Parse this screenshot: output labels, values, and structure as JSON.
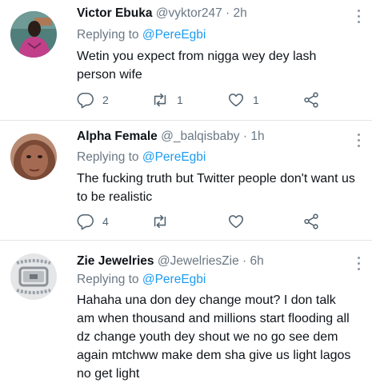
{
  "tweets": [
    {
      "name": "Victor Ebuka",
      "handle": "@vyktor247",
      "separator": "·",
      "time": "2h",
      "replying_prefix": "Replying to",
      "replying_to": "@PereEgbi",
      "text": "Wetin you expect from nigga wey dey lash person wife",
      "replies": "2",
      "retweets": "1",
      "likes": "1",
      "avatar_bg": "#4a7a78"
    },
    {
      "name": "Alpha Female",
      "handle": "@_balqisbaby",
      "separator": "·",
      "time": "1h",
      "replying_prefix": "Replying to",
      "replying_to": "@PereEgbi",
      "text": "The fucking truth but Twitter people don't want us to be realistic",
      "replies": "4",
      "retweets": "",
      "likes": "",
      "avatar_bg": "#8a5a48"
    },
    {
      "name": "Zie Jewelries",
      "handle": "@JewelriesZie",
      "separator": "·",
      "time": "6h",
      "replying_prefix": "Replying to",
      "replying_to": "@PereEgbi",
      "text": "Hahaha una don dey change mout? I don talk am when thousand and millions start flooding all dz change youth dey shout we no go see dem again mtchww make dem sha give us light lagos no get light",
      "avatar_bg": "#d9dcdf"
    }
  ],
  "colors": {
    "accent": "#1d9bf0",
    "secondary_text": "#6b7884",
    "divider": "#e1e6ea"
  },
  "icons": {
    "reply": "reply-icon",
    "retweet": "retweet-icon",
    "like": "heart-icon",
    "share": "share-icon",
    "more": "more-options-icon"
  }
}
